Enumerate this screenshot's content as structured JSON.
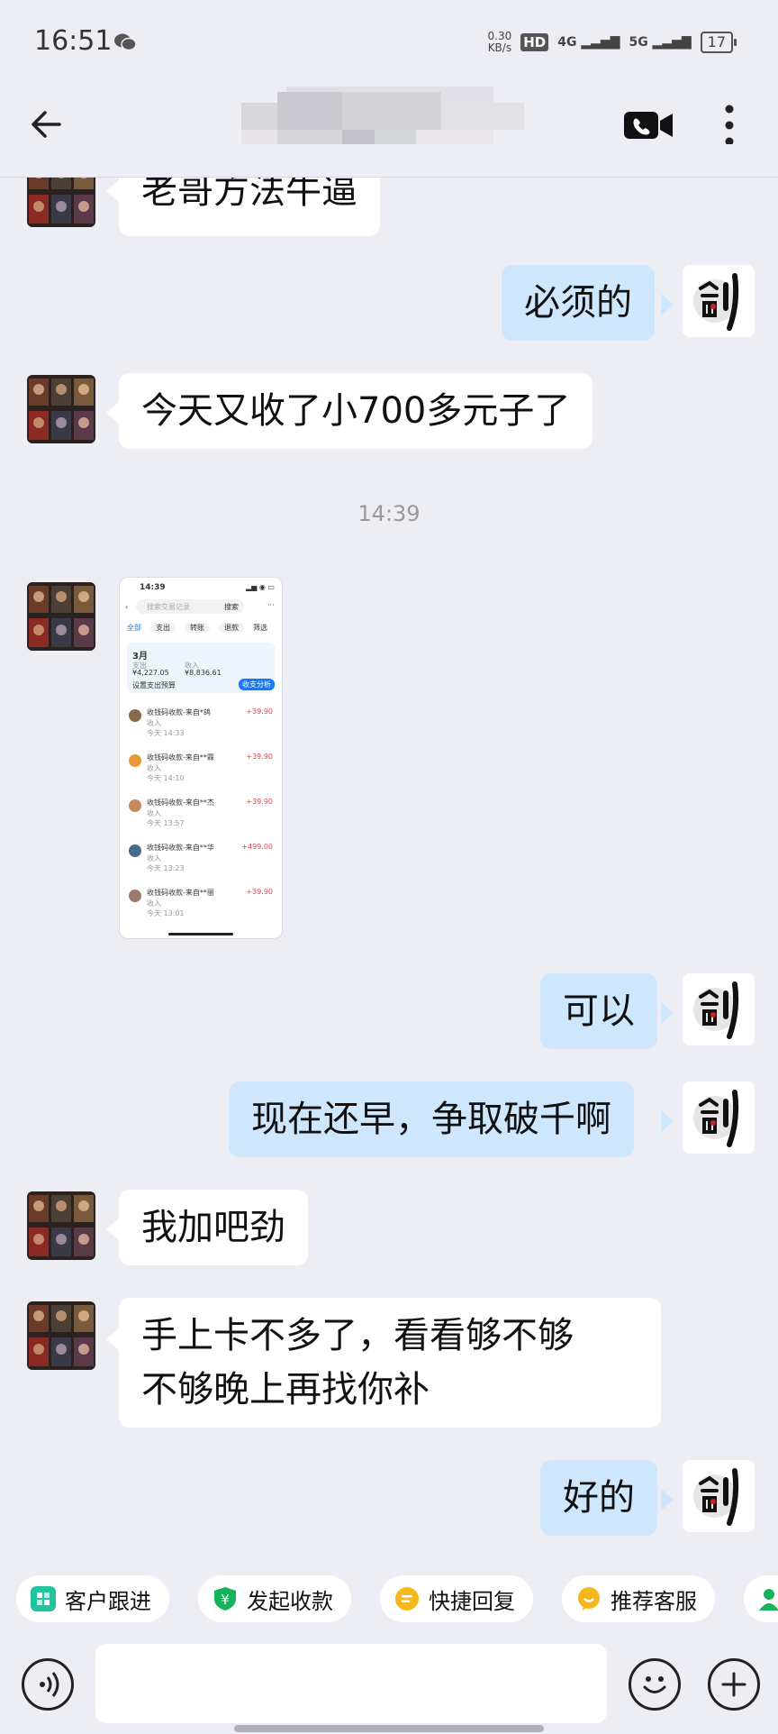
{
  "status_bar": {
    "time": "16:51",
    "net_speed_value": "0.30",
    "net_speed_unit": "KB/s",
    "hd": "HD",
    "network_4g": "4G",
    "network_5g": "5G",
    "battery": "17"
  },
  "header": {
    "back_icon": "back-arrow-icon",
    "video_icon": "video-call-icon",
    "more_icon": "more-vertical-icon"
  },
  "messages": [
    {
      "side": "in",
      "text": "老哥方法牛逼"
    },
    {
      "side": "out",
      "text": "必须的"
    },
    {
      "side": "in",
      "text": "今天又收了小700多元子了"
    },
    {
      "side": "out",
      "text": "可以"
    },
    {
      "side": "out",
      "text": "现在还早，争取破千啊"
    },
    {
      "side": "in",
      "text": "我加吧劲"
    },
    {
      "side": "in",
      "text": "手上卡不多了，看看够不够",
      "text2": "不够晚上再找你补"
    },
    {
      "side": "out",
      "text": "好的"
    }
  ],
  "timestamp": "14:39",
  "thumbnail": {
    "time": "14:39",
    "search_placeholder": "搜索交易记录",
    "search_button": "搜索",
    "tabs": [
      "全部",
      "支出",
      "转账",
      "退款",
      "筛选"
    ],
    "month": "3月",
    "expense_label": "支出",
    "expense_value": "¥4,227.05",
    "income_label": "收入",
    "income_value": "¥8,836.61",
    "budget_link": "设置支出预算",
    "analysis_button": "收支分析",
    "items": [
      {
        "title": "收钱码收款-来自*鸽",
        "amount": "+39.90",
        "time": "今天 14:33"
      },
      {
        "title": "收钱码收款-来自**霖",
        "amount": "+39.90",
        "time": "今天 14:10"
      },
      {
        "title": "收钱码收款-来自**杰",
        "amount": "+39.90",
        "time": "今天 13:57"
      },
      {
        "title": "收钱码收款-来自**华",
        "amount": "+499.00",
        "time": "今天 13:23"
      },
      {
        "title": "收钱码收款-来自**丽",
        "amount": "+39.90",
        "time": "今天 13:01"
      }
    ],
    "income_tag": "收入"
  },
  "quick_actions": [
    {
      "label": "客户跟进",
      "color": "#20c5a0"
    },
    {
      "label": "发起收款",
      "color": "#16b35a"
    },
    {
      "label": "快捷回复",
      "color": "#f5b81c"
    },
    {
      "label": "推荐客服",
      "color": "#f5b81c"
    }
  ],
  "colors": {
    "background": "#ededf4",
    "bubble_out": "#cfe7fd",
    "bubble_in": "#ffffff",
    "amount_red": "#e0454c"
  }
}
